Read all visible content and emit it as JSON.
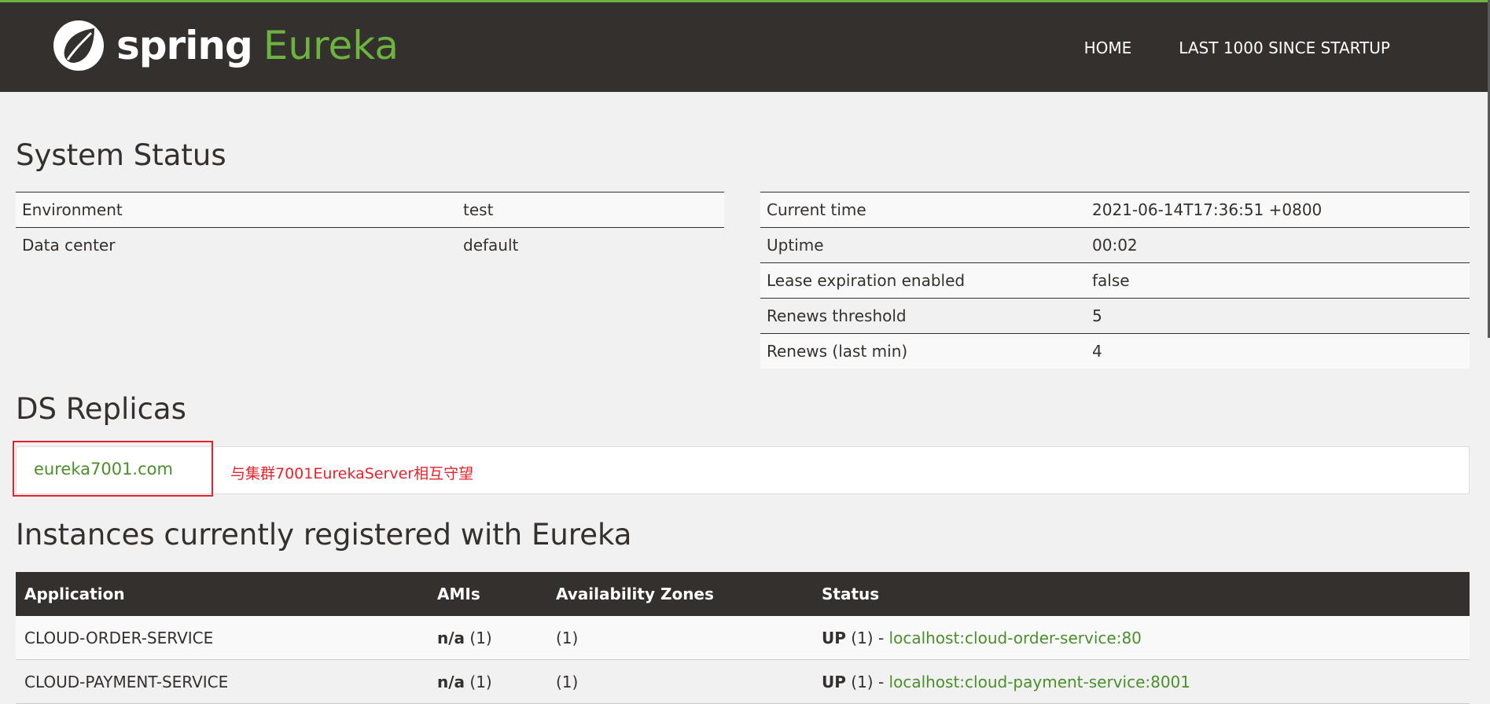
{
  "brand": {
    "spring": "spring",
    "eureka": "Eureka"
  },
  "nav": {
    "home": "HOME",
    "last1000": "LAST 1000 SINCE STARTUP"
  },
  "system_status": {
    "title": "System Status",
    "left": [
      {
        "label": "Environment",
        "value": "test"
      },
      {
        "label": "Data center",
        "value": "default"
      }
    ],
    "right": [
      {
        "label": "Current time",
        "value": "2021-06-14T17:36:51 +0800"
      },
      {
        "label": "Uptime",
        "value": "00:02"
      },
      {
        "label": "Lease expiration enabled",
        "value": "false"
      },
      {
        "label": "Renews threshold",
        "value": "5"
      },
      {
        "label": "Renews (last min)",
        "value": "4"
      }
    ]
  },
  "ds_replicas": {
    "title": "DS Replicas",
    "link": "eureka7001.com",
    "annotation": "与集群7001EurekaServer相互守望"
  },
  "instances": {
    "title": "Instances currently registered with Eureka",
    "headers": [
      "Application",
      "AMIs",
      "Availability Zones",
      "Status"
    ],
    "rows": [
      {
        "app": "CLOUD-ORDER-SERVICE",
        "ami_na": "n/a",
        "ami_count": "(1)",
        "zones": "(1)",
        "status_up": "UP",
        "status_count": "(1) -",
        "link": "localhost:cloud-order-service:80"
      },
      {
        "app": "CLOUD-PAYMENT-SERVICE",
        "ami_na": "n/a",
        "ami_count": "(1)",
        "zones": "(1)",
        "status_up": "UP",
        "status_count": "(1) -",
        "link": "localhost:cloud-payment-service:8001"
      }
    ]
  },
  "colors": {
    "brand_green": "#6db33f",
    "dark": "#34302d",
    "annotation_red": "#e8222b"
  }
}
